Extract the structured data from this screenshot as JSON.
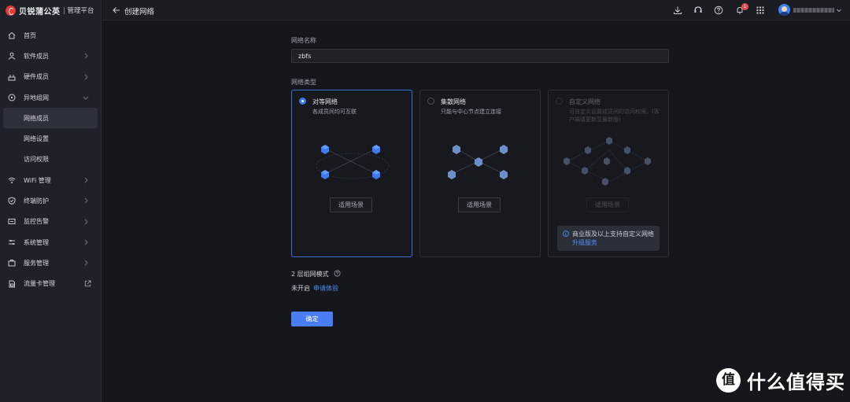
{
  "brand": {
    "name": "贝锐蒲公英",
    "subtitle": "管理平台"
  },
  "sidebar": {
    "items": [
      {
        "label": "首页",
        "icon": "home-icon"
      },
      {
        "label": "软件成员",
        "icon": "user-icon"
      },
      {
        "label": "硬件成员",
        "icon": "router-icon"
      },
      {
        "label": "异地组网",
        "icon": "network-icon"
      },
      {
        "label": "网络成员"
      },
      {
        "label": "网络设置"
      },
      {
        "label": "访问权限"
      },
      {
        "label": "WiFi 管理",
        "icon": "wifi-icon"
      },
      {
        "label": "终端防护",
        "icon": "shield-icon"
      },
      {
        "label": "监控告警",
        "icon": "monitor-icon"
      },
      {
        "label": "系统管理",
        "icon": "sliders-icon"
      },
      {
        "label": "服务管理",
        "icon": "briefcase-icon"
      },
      {
        "label": "流量卡管理",
        "icon": "sim-card-icon"
      }
    ]
  },
  "header": {
    "title": "创建网络",
    "notification_count": "1"
  },
  "form": {
    "name_label": "网络名称",
    "name_value": "zbfs",
    "type_label": "网络类型",
    "types": [
      {
        "title": "对等网络",
        "desc": "各成员间均可互联",
        "button": "适用场景",
        "selected": true
      },
      {
        "title": "集散网络",
        "desc": "只能与中心节点建立连接",
        "button": "适用场景",
        "selected": false
      },
      {
        "title": "自定义网络",
        "desc": "可自定义设置成员间的访问权限。(客户端请更新至最新版)",
        "button": "适用场景",
        "selected": false,
        "disabled": true
      }
    ],
    "notice_text": "商业版及以上支持自定义网络",
    "notice_link": "升级服务",
    "mode_label": "2 层组网模式",
    "mode_status": "未开启",
    "mode_link": "申请体验",
    "submit": "确定"
  },
  "watermark": "什么值得买",
  "colors": {
    "accent": "#4a7cf3",
    "selected_border": "#3b6fd1",
    "badge": "#e5484d",
    "brand": "#e53935"
  }
}
